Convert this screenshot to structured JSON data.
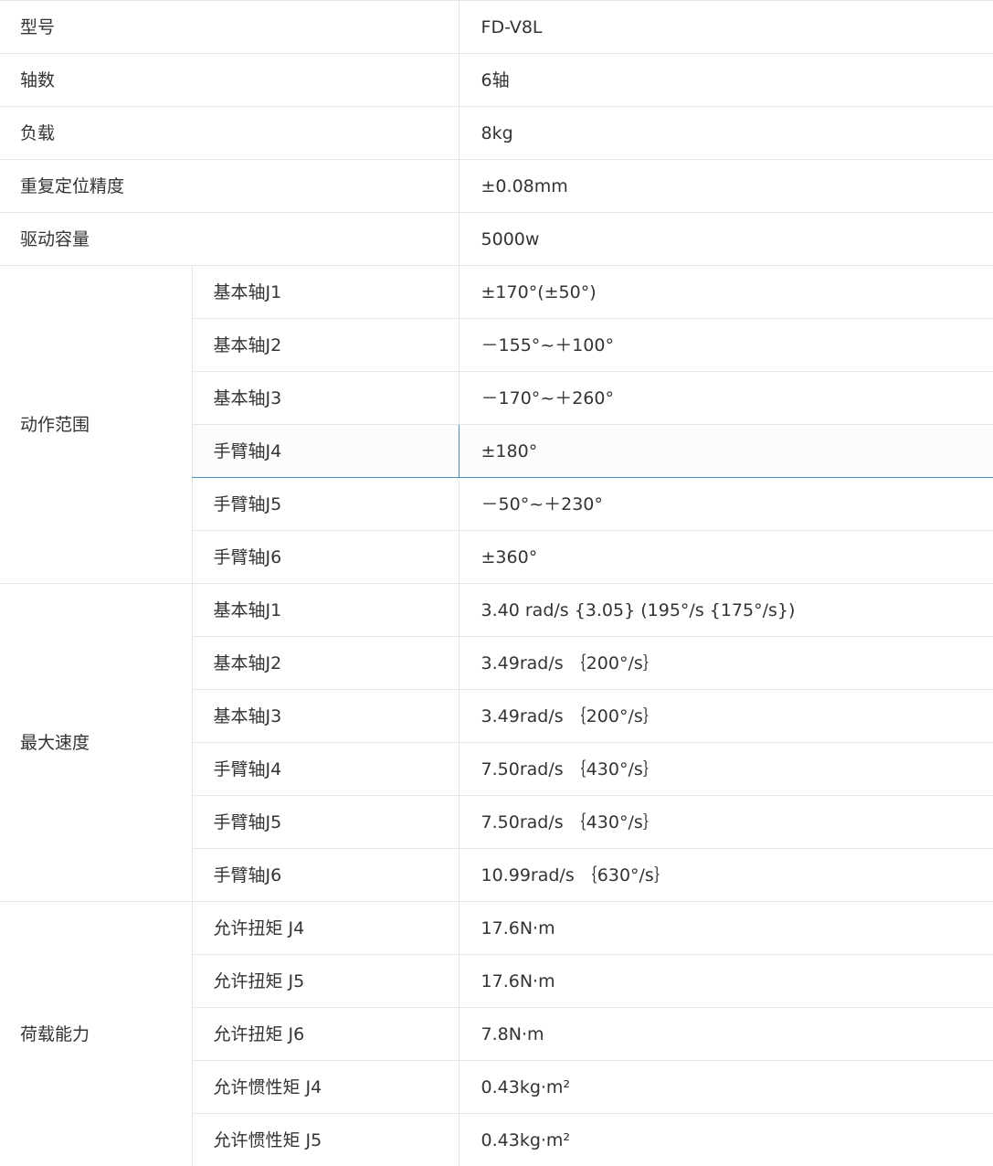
{
  "rows_simple": [
    {
      "label": "型号",
      "value": "FD-V8L"
    },
    {
      "label": "轴数",
      "value": "6轴"
    },
    {
      "label": "负载",
      "value": "8kg"
    },
    {
      "label": "重复定位精度",
      "value": "±0.08mm"
    },
    {
      "label": "驱动容量",
      "value": "5000w"
    }
  ],
  "motion_range": {
    "label": "动作范围",
    "items": [
      {
        "axis": "基本轴J1",
        "value": "±170°(±50°)"
      },
      {
        "axis": "基本轴J2",
        "value": "－155°~＋100°"
      },
      {
        "axis": "基本轴J3",
        "value": "－170°~＋260°"
      },
      {
        "axis": "手臂轴J4",
        "value": "±180°"
      },
      {
        "axis": "手臂轴J5",
        "value": "－50°~＋230°"
      },
      {
        "axis": "手臂轴J6",
        "value": "±360°"
      }
    ]
  },
  "max_speed": {
    "label": "最大速度",
    "items": [
      {
        "axis": "基本轴J1",
        "value": "3.40 rad/s {3.05} (195°/s {175°/s})"
      },
      {
        "axis": "基本轴J2",
        "value": "3.49rad/s ｛200°/s｝"
      },
      {
        "axis": "基本轴J3",
        "value": "3.49rad/s ｛200°/s｝"
      },
      {
        "axis": "手臂轴J4",
        "value": "7.50rad/s ｛430°/s｝"
      },
      {
        "axis": "手臂轴J5",
        "value": "7.50rad/s ｛430°/s｝"
      },
      {
        "axis": "手臂轴J6",
        "value": "10.99rad/s ｛630°/s｝"
      }
    ]
  },
  "load_capacity": {
    "label": "荷载能力",
    "items": [
      {
        "axis": "允许扭矩 J4",
        "value": "17.6N·m"
      },
      {
        "axis": "允许扭矩 J5",
        "value": "17.6N·m"
      },
      {
        "axis": "允许扭矩 J6",
        "value": "7.8N·m"
      },
      {
        "axis": "允许惯性矩 J4",
        "value": "0.43kg·m²"
      },
      {
        "axis": "允许惯性矩 J5",
        "value": "0.43kg·m²"
      }
    ]
  }
}
